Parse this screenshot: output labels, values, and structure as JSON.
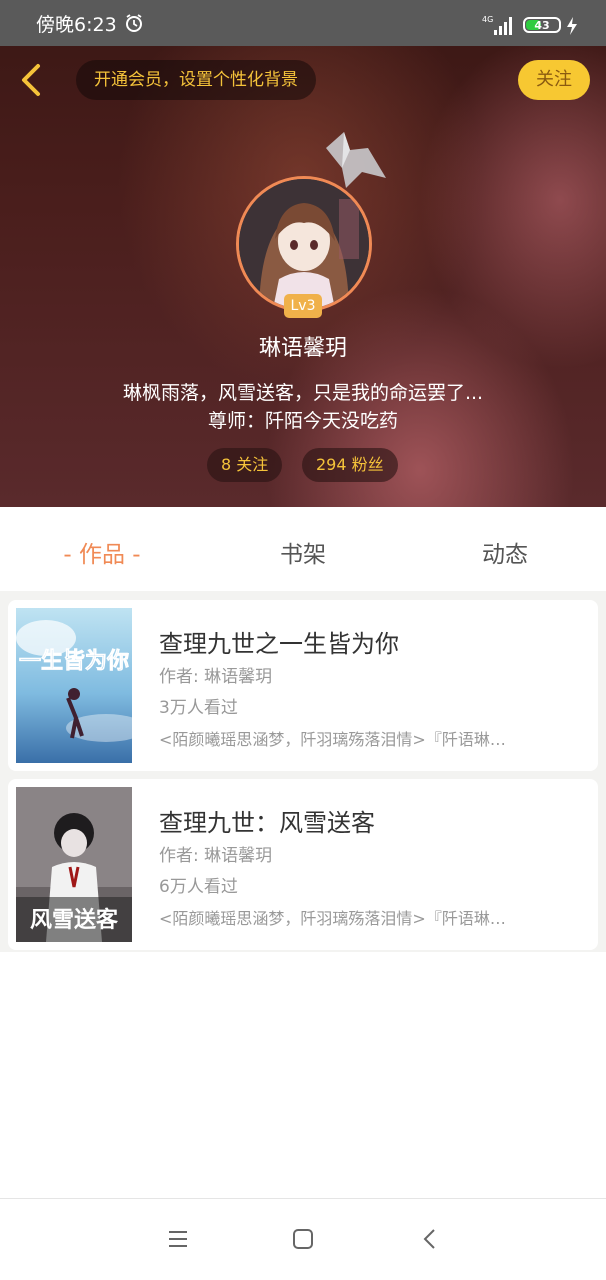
{
  "status_bar": {
    "time": "傍晚6:23",
    "network": "4G",
    "battery": "43",
    "battery_level": 0.43
  },
  "header": {
    "vip_prompt": "开通会员，设置个性化背景",
    "follow_label": "关注",
    "level": "Lv3",
    "username": "琳语馨玥",
    "bio": "琳枫雨落，风雪送客，只是我的命运罢了...",
    "mentor": "尊师：阡陌今天没吃药",
    "following": "8 关注",
    "followers": "294 粉丝"
  },
  "tabs": [
    {
      "label": "- 作品 -",
      "active": true
    },
    {
      "label": "书架",
      "active": false
    },
    {
      "label": "动态",
      "active": false
    }
  ],
  "books": [
    {
      "title": "查理九世之一生皆为你",
      "author": "作者: 琳语馨玥",
      "views": "3万人看过",
      "desc": "<陌颜曦瑶思涵梦，阡羽璃殇落泪情>『阡语琳…",
      "cover_text": "一生皆为你"
    },
    {
      "title": "查理九世：风雪送客",
      "author": "作者: 琳语馨玥",
      "views": "6万人看过",
      "desc": "<陌颜曦瑶思涵梦，阡羽璃殇落泪情>『阡语琳…",
      "cover_text": "风雪送客"
    }
  ],
  "colors": {
    "accent": "#f08a55",
    "gold": "#f5c33a",
    "follow_bg": "#f7c832"
  },
  "icons": [
    "alarm-icon",
    "signal-icon",
    "battery-icon",
    "charging-icon",
    "back-arrow-icon",
    "menu-icon",
    "home-icon",
    "back-icon"
  ]
}
